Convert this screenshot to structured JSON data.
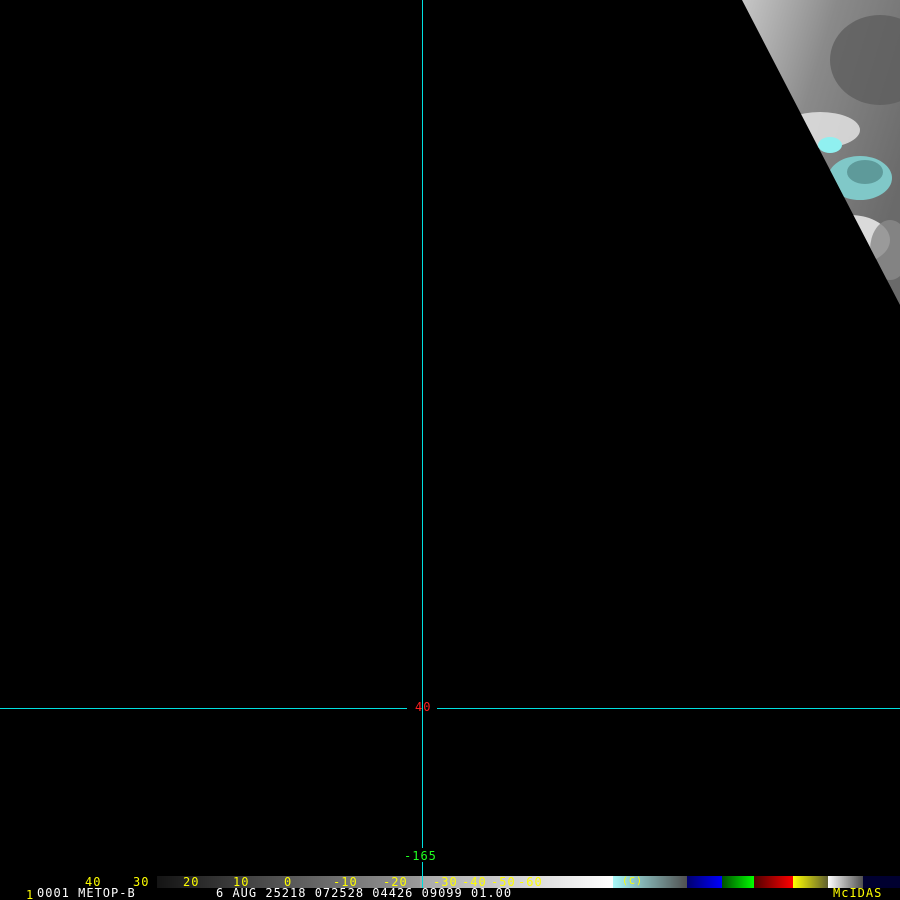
{
  "satellite_image": {
    "grid": {
      "latitude_label": "40",
      "longitude_label": "-165",
      "line_color": "#00e0e0"
    },
    "colorbar": {
      "labels": [
        "40",
        "30",
        "20",
        "10",
        "0",
        "-10",
        "-20",
        "-30",
        "-40",
        "-50",
        "-60"
      ],
      "unit_label": "(C)"
    },
    "footer": {
      "frame_number": "1",
      "source": "0001 METOP-B",
      "datetime_info": "6 AUG 25218 072528 04426 09099 01.00",
      "brand": "McIDAS"
    }
  }
}
